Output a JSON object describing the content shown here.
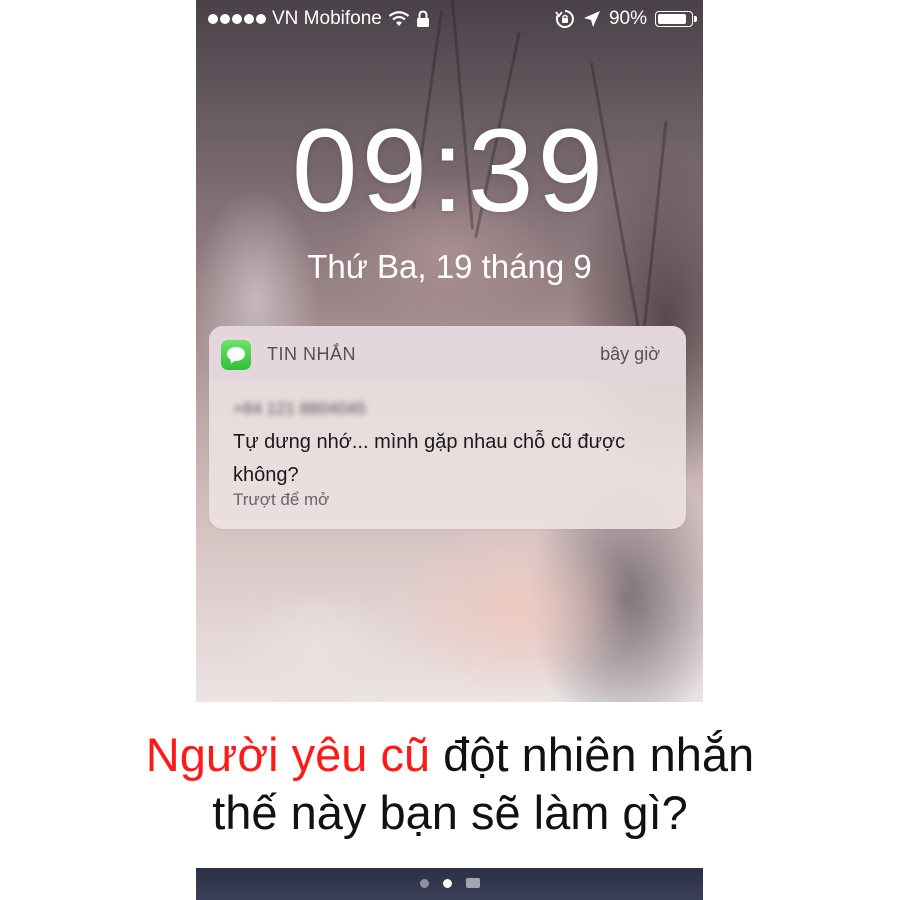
{
  "status_bar": {
    "carrier": "VN Mobifone",
    "battery": "90%",
    "battery_level": 0.9,
    "signal_bars": 5
  },
  "lock_screen": {
    "time": "09:39",
    "date": "Thứ Ba, 19 tháng 9"
  },
  "notification": {
    "app_name": "TIN NHẮN",
    "time": "bây giờ",
    "sender": "+84 121 8804045",
    "message": "Tự dưng nhớ... mình gặp nhau chỗ cũ được không?",
    "hint": "Trượt để mở",
    "icon": "messages-icon"
  },
  "caption": {
    "highlight": "Người yêu cũ",
    "rest_line1": " đột nhiên nhắn",
    "line2": "thế này bạn sẽ làm gì?",
    "highlight_color": "#ff1a1a"
  },
  "icons": {
    "wifi": "wifi-icon",
    "lock": "lock-icon",
    "rotation_lock": "rotation-lock-icon",
    "location": "location-arrow-icon",
    "battery": "battery-icon",
    "camera": "camera-icon"
  }
}
